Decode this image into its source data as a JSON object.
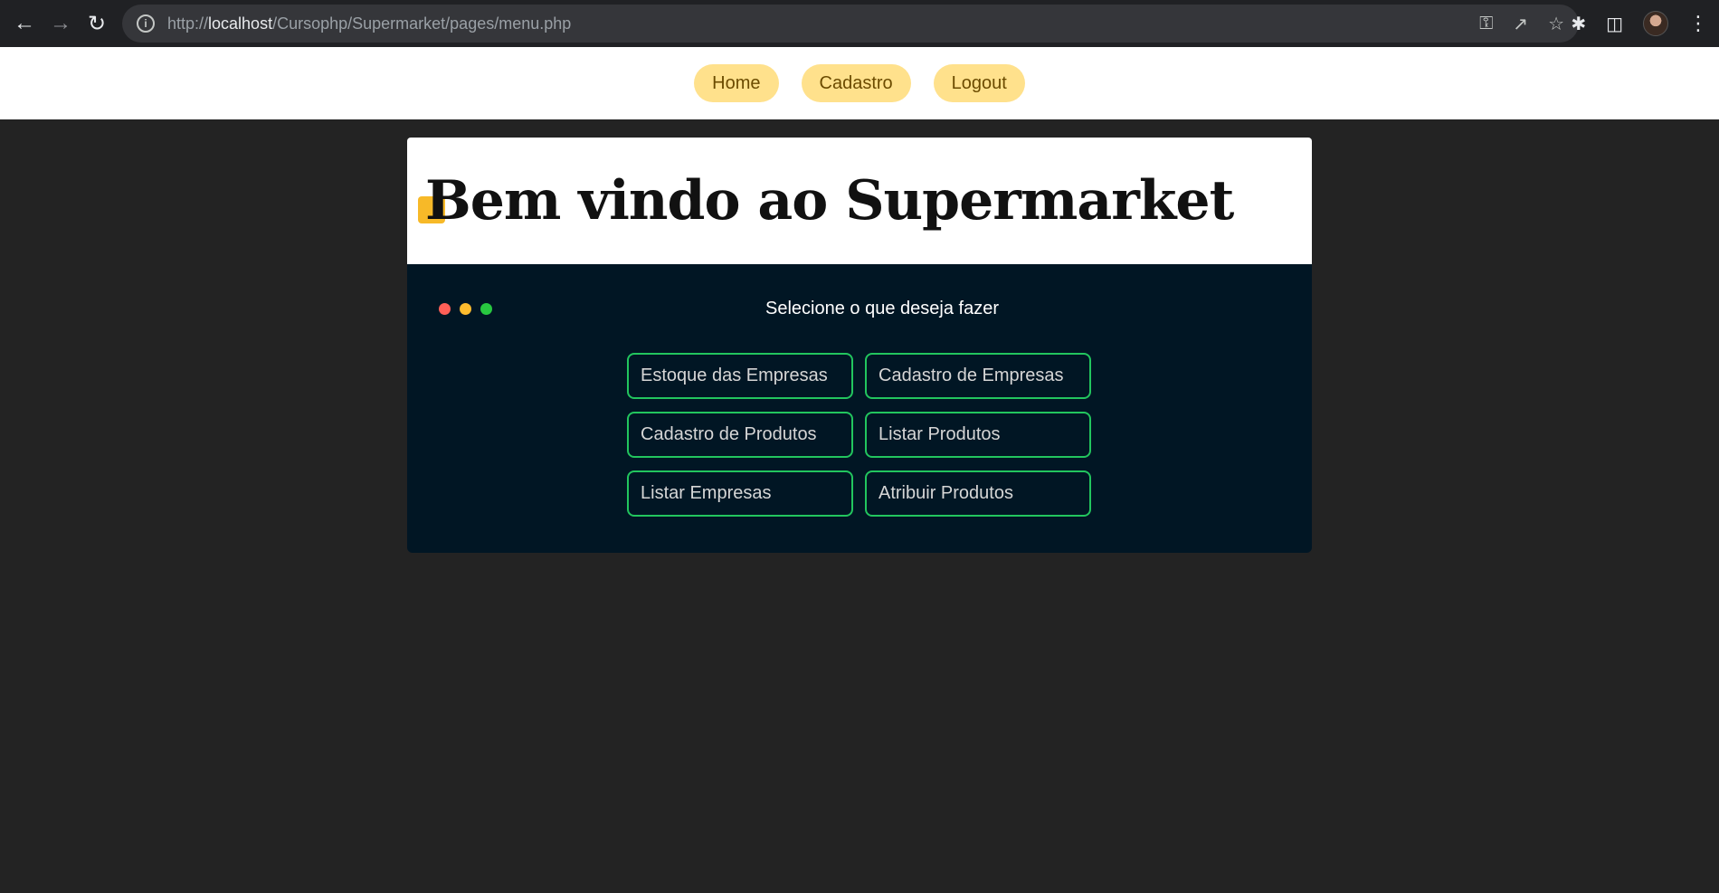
{
  "browser": {
    "url_prefix": "http://",
    "url_host": "localhost",
    "url_path": "/Cursophp/Supermarket/pages/menu.php",
    "icons": [
      "back-icon",
      "forward-icon",
      "reload-icon",
      "info-icon",
      "key-icon",
      "share-icon",
      "star-icon",
      "extensions-icon",
      "sidepanel-icon",
      "profile-avatar",
      "menu-icon"
    ]
  },
  "nav": {
    "items": [
      {
        "label": "Home"
      },
      {
        "label": "Cadastro"
      },
      {
        "label": "Logout"
      }
    ]
  },
  "hero": {
    "title": "Bem vindo ao Supermarket"
  },
  "panel": {
    "subtitle": "Selecione o que deseja fazer",
    "dot_colors": [
      "#ff5f57",
      "#febc2e",
      "#28c840"
    ],
    "actions": [
      {
        "label": "Estoque das Empresas"
      },
      {
        "label": "Cadastro de Empresas"
      },
      {
        "label": "Cadastro de Produtos"
      },
      {
        "label": "Listar Produtos"
      },
      {
        "label": "Listar Empresas"
      },
      {
        "label": "Atribuir Produtos"
      }
    ]
  },
  "colors": {
    "page_bg": "#232323",
    "pill_bg": "#ffe18c",
    "panel_bg": "#011624",
    "action_border": "#22c55e",
    "badge": "#f7b928"
  }
}
